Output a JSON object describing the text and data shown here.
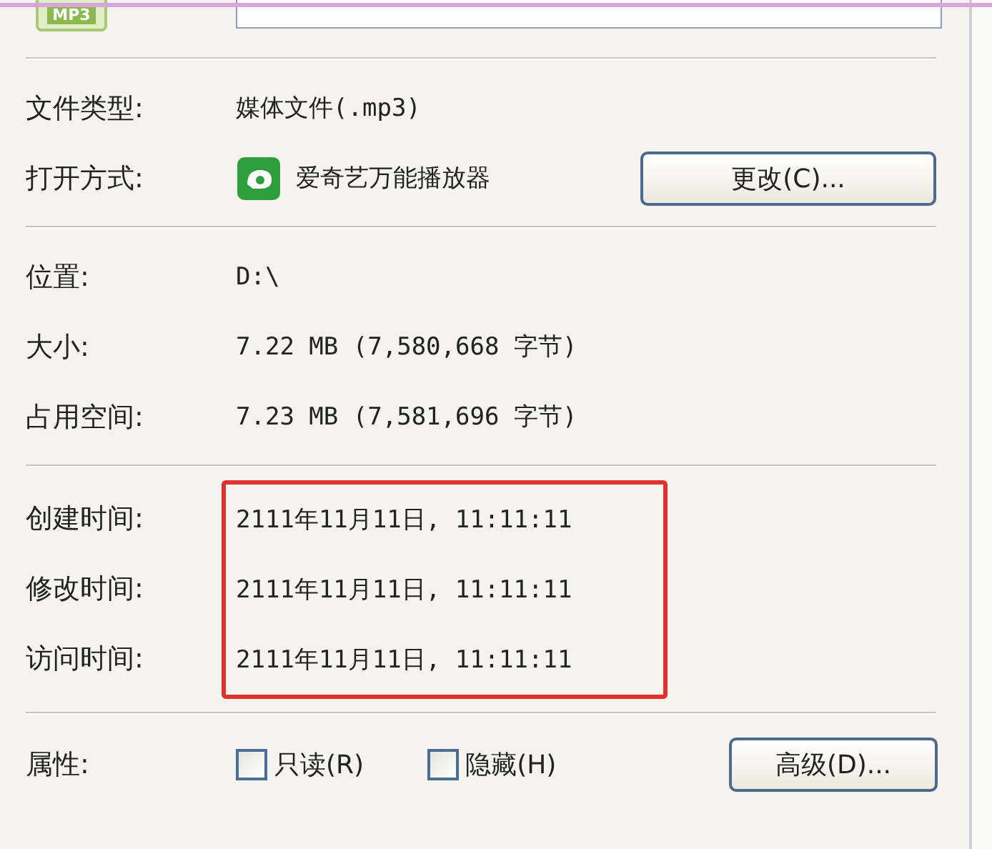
{
  "file_icon": {
    "badge": "MP3"
  },
  "general": [
    {
      "label": "文件类型:",
      "value": "媒体文件(.mp3)"
    },
    {
      "label": "打开方式:",
      "value": "爱奇艺万能播放器",
      "kind": "app",
      "button": "更改(C)..."
    }
  ],
  "location": [
    {
      "label": "位置:",
      "value": "D:\\"
    },
    {
      "label": "大小:",
      "value": "7.22 MB (7,580,668 字节)"
    },
    {
      "label": "占用空间:",
      "value": "7.23 MB (7,581,696 字节)"
    }
  ],
  "times": {
    "highlighted": true,
    "rows": [
      {
        "label": "创建时间:",
        "value": "2111年11月11日, 11:11:11"
      },
      {
        "label": "修改时间:",
        "value": "2111年11月11日, 11:11:11"
      },
      {
        "label": "访问时间:",
        "value": "2111年11月11日, 11:11:11"
      }
    ]
  },
  "attributes": {
    "label": "属性:",
    "checkboxes": [
      {
        "label": "只读(R)",
        "checked": false
      },
      {
        "label": "隐藏(H)",
        "checked": false
      }
    ],
    "button": "高级(D)..."
  }
}
